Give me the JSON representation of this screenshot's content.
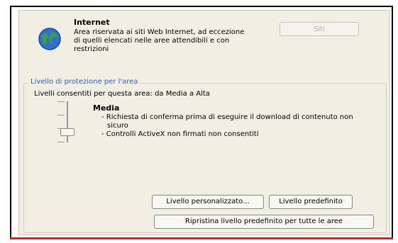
{
  "zone": {
    "title": "Internet",
    "description": "Area riservata ai siti Web Internet, ad eccezione di quelli elencati nelle aree attendibili e con restrizioni",
    "sites_button": "Siti",
    "icon": "globe-icon"
  },
  "security_level": {
    "group_title": "Livello di protezione per l'area",
    "allowed_levels": "Livelli consentiti per questa area: da Media a Alta",
    "current_level": "Media",
    "details": [
      "- Richiesta di conferma prima di eseguire il download di contenuto non sicuro",
      "- Controlli ActiveX non firmati non consentiti"
    ]
  },
  "buttons": {
    "custom_level": "Livello personalizzato...",
    "default_level": "Livello predefinito",
    "reset_all": "Ripristina livello predefinito per tutte le aree"
  },
  "colors": {
    "dialog_background": "#f1efe4",
    "group_title": "#2b5fd0",
    "underline": "#e0201a"
  }
}
